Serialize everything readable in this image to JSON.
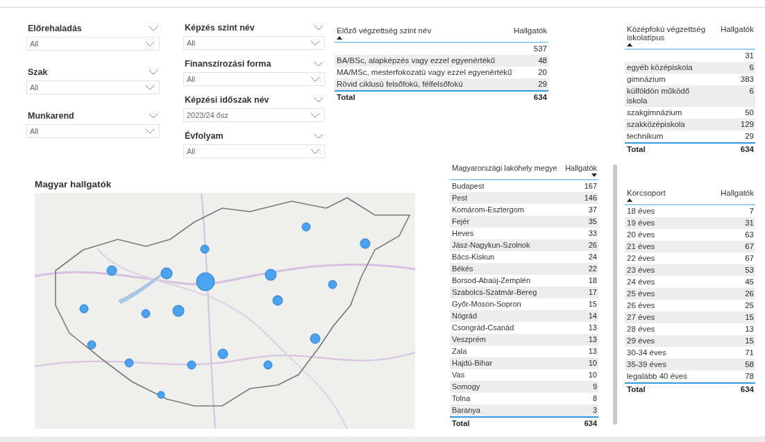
{
  "slicer_columns": [
    [
      {
        "title": "Előrehaladás",
        "value": "All"
      },
      {
        "title": "Szak",
        "value": "All"
      },
      {
        "title": "Munkarend",
        "value": "All"
      }
    ],
    [
      {
        "title": "Képzés szint név",
        "value": "All"
      },
      {
        "title": "Finanszírozási forma",
        "value": "All"
      },
      {
        "title": "Képzési időszak név",
        "value": "2023/24 ősz"
      },
      {
        "title": "Évfolyam",
        "value": "All"
      }
    ]
  ],
  "tables": [
    {
      "columns": [
        {
          "label": "Előző végzettség szint név",
          "sorted": true,
          "descending": false
        },
        {
          "label": "Hallgatók",
          "sorted": false
        }
      ],
      "rows": [
        {
          "value": "537"
        },
        {
          "label": "BA/BSc, alapképzés vagy ezzel egyenértékű",
          "value": "48"
        },
        {
          "label": "MA/MSc, mesterfokozatú vagy ezzel egyenértékű",
          "value": "20"
        },
        {
          "label": "Rövid ciklusú felsőfokú, félfelsőfokú",
          "value": "29"
        }
      ],
      "total": {
        "label": "Total",
        "value": "634"
      }
    },
    {
      "columns": [
        {
          "label": "Középfokú végzettség iskolatípus",
          "sorted": true,
          "descending": false
        },
        {
          "label": "Hallgatók",
          "sorted": false
        }
      ],
      "rows": [
        {
          "value": "31"
        },
        {
          "label": "egyéb középiskola",
          "value": "6"
        },
        {
          "label": "gimnázium",
          "value": "383"
        },
        {
          "label": "külföldön működő iskola",
          "value": "6"
        },
        {
          "label": "szakgimnázium",
          "value": "50"
        },
        {
          "label": "szakközépiskola",
          "value": "129"
        },
        {
          "label": "technikum",
          "value": "29"
        }
      ],
      "total": {
        "label": "Total",
        "value": "634"
      }
    },
    {
      "columns": [
        {
          "label": "Magyarországi lakóhely megye",
          "sorted": false
        },
        {
          "label": "Hallgatók",
          "sorted": true,
          "descending": true
        }
      ],
      "rows": [
        {
          "label": "Budapest",
          "value": "167"
        },
        {
          "label": "Pest",
          "value": "146"
        },
        {
          "label": "Komárom-Esztergom",
          "value": "37"
        },
        {
          "label": "Fejér",
          "value": "35"
        },
        {
          "label": "Heves",
          "value": "33"
        },
        {
          "label": "Jász-Nagykun-Szolnok",
          "value": "26"
        },
        {
          "label": "Bács-Kiskun",
          "value": "24"
        },
        {
          "label": "Békés",
          "value": "22"
        },
        {
          "label": "Borsod-Abaúj-Zemplén",
          "value": "18"
        },
        {
          "label": "Szabolcs-Szatmár-Bereg",
          "value": "17"
        },
        {
          "label": "Győr-Moson-Sopron",
          "value": "15"
        },
        {
          "label": "Nógrád",
          "value": "14"
        },
        {
          "label": "Csongrád-Csanád",
          "value": "13"
        },
        {
          "label": "Veszprém",
          "value": "13"
        },
        {
          "label": "Zala",
          "value": "13"
        },
        {
          "label": "Hajdú-Bihar",
          "value": "10"
        },
        {
          "label": "Vas",
          "value": "10"
        },
        {
          "label": "Somogy",
          "value": "9"
        },
        {
          "label": "Tolna",
          "value": "8"
        },
        {
          "label": "Baranya",
          "value": "3"
        }
      ],
      "total": {
        "label": "Total",
        "value": "634"
      }
    },
    {
      "columns": [
        {
          "label": "Korcsoport",
          "sorted": true,
          "descending": false
        },
        {
          "label": "Hallgatók",
          "sorted": false
        }
      ],
      "rows": [
        {
          "label": "18 éves",
          "value": "7"
        },
        {
          "label": "19 éves",
          "value": "31"
        },
        {
          "label": "20 éves",
          "value": "63"
        },
        {
          "label": "21 éves",
          "value": "67"
        },
        {
          "label": "22 éves",
          "value": "67"
        },
        {
          "label": "23 éves",
          "value": "53"
        },
        {
          "label": "24 éves",
          "value": "45"
        },
        {
          "label": "25 éves",
          "value": "26"
        },
        {
          "label": "26 éves",
          "value": "25"
        },
        {
          "label": "27 éves",
          "value": "15"
        },
        {
          "label": "28 éves",
          "value": "13"
        },
        {
          "label": "29 éves",
          "value": "15"
        },
        {
          "label": "30-34 éves",
          "value": "71"
        },
        {
          "label": "35-39 éves",
          "value": "58"
        },
        {
          "label": "legalább 40 éves",
          "value": "78"
        }
      ],
      "total": {
        "label": "Total",
        "value": "634"
      }
    }
  ],
  "map": {
    "title": "Magyar hallgatók"
  }
}
